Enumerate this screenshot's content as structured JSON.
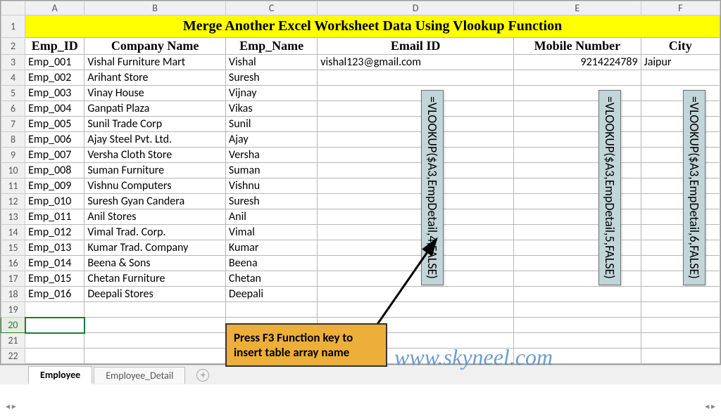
{
  "title": "Merge Another Excel Worksheet Data Using Vlookup Function",
  "columns": [
    "A",
    "B",
    "C",
    "D",
    "E",
    "F"
  ],
  "headers": {
    "emp_id": "Emp_ID",
    "company": "Company Name",
    "emp_name": "Emp_Name",
    "email": "Email ID",
    "mobile": "Mobile Number",
    "city": "City"
  },
  "rows": [
    {
      "n": 3,
      "id": "Emp_001",
      "co": "Vishal Furniture Mart",
      "nm": "Vishal",
      "em": "vishal123@gmail.com",
      "mo": "9214224789",
      "ci": "Jaipur"
    },
    {
      "n": 4,
      "id": "Emp_002",
      "co": "Arihant Store",
      "nm": "Suresh",
      "em": "",
      "mo": "",
      "ci": ""
    },
    {
      "n": 5,
      "id": "Emp_003",
      "co": "Vinay House",
      "nm": "Vijnay",
      "em": "",
      "mo": "",
      "ci": ""
    },
    {
      "n": 6,
      "id": "Emp_004",
      "co": "Ganpati Plaza",
      "nm": "Vikas",
      "em": "",
      "mo": "",
      "ci": ""
    },
    {
      "n": 7,
      "id": "Emp_005",
      "co": "Sunil Trade Corp",
      "nm": "Sunil",
      "em": "",
      "mo": "",
      "ci": ""
    },
    {
      "n": 8,
      "id": "Emp_006",
      "co": "Ajay Steel Pvt. Ltd.",
      "nm": "Ajay",
      "em": "",
      "mo": "",
      "ci": ""
    },
    {
      "n": 9,
      "id": "Emp_007",
      "co": "Versha Cloth Store",
      "nm": "Versha",
      "em": "",
      "mo": "",
      "ci": ""
    },
    {
      "n": 10,
      "id": "Emp_008",
      "co": "Suman Furniture",
      "nm": "Suman",
      "em": "",
      "mo": "",
      "ci": ""
    },
    {
      "n": 11,
      "id": "Emp_009",
      "co": "Vishnu Computers",
      "nm": "Vishnu",
      "em": "",
      "mo": "",
      "ci": ""
    },
    {
      "n": 12,
      "id": "Emp_010",
      "co": "Suresh Gyan Candera",
      "nm": "Suresh",
      "em": "",
      "mo": "",
      "ci": ""
    },
    {
      "n": 13,
      "id": "Emp_011",
      "co": "Anil Stores",
      "nm": "Anil",
      "em": "",
      "mo": "",
      "ci": ""
    },
    {
      "n": 14,
      "id": "Emp_012",
      "co": "Vimal Trad. Corp.",
      "nm": "Vimal",
      "em": "",
      "mo": "",
      "ci": ""
    },
    {
      "n": 15,
      "id": "Emp_013",
      "co": "Kumar Trad. Company",
      "nm": "Kumar",
      "em": "",
      "mo": "",
      "ci": ""
    },
    {
      "n": 16,
      "id": "Emp_014",
      "co": "Beena & Sons",
      "nm": "Beena",
      "em": "",
      "mo": "",
      "ci": ""
    },
    {
      "n": 17,
      "id": "Emp_015",
      "co": "Chetan Furniture",
      "nm": "Chetan",
      "em": "",
      "mo": "",
      "ci": ""
    },
    {
      "n": 18,
      "id": "Emp_016",
      "co": "Deepali Stores",
      "nm": "Deepali",
      "em": "",
      "mo": "",
      "ci": ""
    }
  ],
  "empty_rows": [
    19,
    20,
    21,
    22
  ],
  "selected_row": 20,
  "formulas": {
    "d": "=VLOOKUP($A3,EmpDetail,4,FALSE)",
    "e": "=VLOOKUP($A3,EmpDetail,5,FALSE)",
    "f": "=VLOOKUP($A3,EmpDetail,6,FALSE)"
  },
  "hint": "Press F3 Function key to insert table array name",
  "watermark": "www.skyneel.com",
  "tabs": {
    "active": "Employee",
    "inactive": "Employee_Detail"
  },
  "add_sheet": "+"
}
